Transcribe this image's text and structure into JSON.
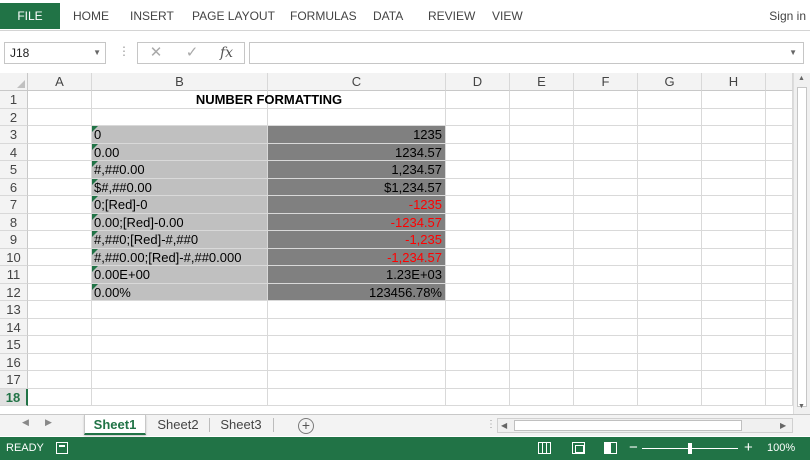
{
  "ribbon": {
    "file_label": "FILE",
    "tabs": [
      "HOME",
      "INSERT",
      "PAGE LAYOUT",
      "FORMULAS",
      "DATA",
      "REVIEW",
      "VIEW"
    ],
    "sign_in": "Sign in"
  },
  "formula_bar": {
    "name_box": "J18",
    "fx_label": "fx",
    "formula": ""
  },
  "grid": {
    "columns": [
      "A",
      "B",
      "C",
      "D",
      "E",
      "F",
      "G",
      "H"
    ],
    "rows": [
      "1",
      "2",
      "3",
      "4",
      "5",
      "6",
      "7",
      "8",
      "9",
      "10",
      "11",
      "12",
      "13",
      "14",
      "15",
      "16",
      "17",
      "18"
    ],
    "active_row": "18",
    "title": "NUMBER FORMATTING",
    "formats": [
      "0",
      "0.00",
      "#,##0.00",
      "$#,##0.00",
      "0;[Red]-0",
      "0.00;[Red]-0.00",
      "#,##0;[Red]-#,##0",
      "#,##0.00;[Red]-#,##0.000",
      "0.00E+00",
      "0.00%"
    ],
    "results": [
      "1235",
      "1234.57",
      "1,234.57",
      "$1,234.57",
      "-1235",
      "-1234.57",
      "-1,235",
      "-1,234.57",
      "1.23E+03",
      "123456.78%"
    ],
    "result_colors": [
      "#000000",
      "#000000",
      "#000000",
      "#000000",
      "#ff0000",
      "#ff0000",
      "#ff0000",
      "#ff0000",
      "#000000",
      "#000000"
    ],
    "format_fill": "#c0c0c0",
    "result_fill": "#808080"
  },
  "sheets": {
    "tabs": [
      "Sheet1",
      "Sheet2",
      "Sheet3"
    ],
    "active": "Sheet1",
    "add_label": "+"
  },
  "status": {
    "ready": "READY",
    "zoom": "100%"
  },
  "colors": {
    "accent": "#217346",
    "negative": "#ff0000"
  }
}
